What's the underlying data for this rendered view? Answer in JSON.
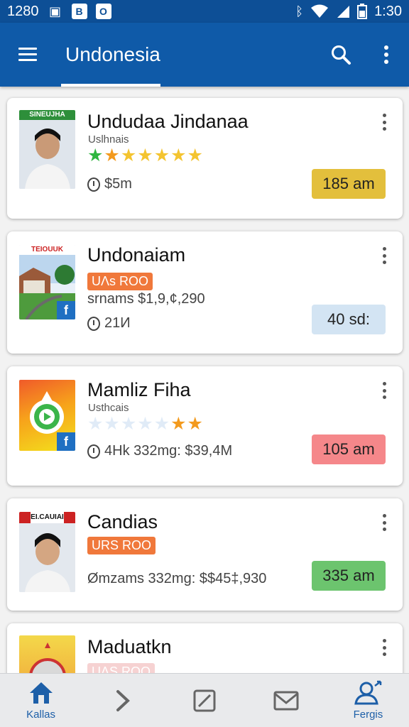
{
  "status_bar": {
    "time_left": "1280",
    "icons_left": [
      "gallery-icon",
      "b-icon",
      "o-icon"
    ],
    "time_right": "1:30"
  },
  "app_bar": {
    "title": "Undonesia",
    "actions": [
      "search-icon",
      "more-vert-icon"
    ]
  },
  "cards": [
    {
      "title": "Undudaa Jindanaa",
      "subtitle": "Uslhnais",
      "thumb_caption": "SINEUJHA",
      "rating_stars": 7,
      "meta": "$5m",
      "badge": "185 am",
      "badge_color": "#e3bf3c"
    },
    {
      "title": "Undonaiam",
      "tag": "UΛs ROO",
      "thumb_caption": "TEIOUUK",
      "line2": "srnams  $1,9,¢,290",
      "meta": "21И",
      "badge": "40 sd:",
      "badge_color": "#d3e4f3"
    },
    {
      "title": "Mamliz Fiha",
      "subtitle": "Usthcais",
      "rating_stars": 2,
      "meta": "4Hk   332mg:  $39,4M",
      "badge": "105 am",
      "badge_color": "#f5878a"
    },
    {
      "title": "Candias",
      "tag": "URS ROO",
      "thumb_caption": "EI.CAUIAI",
      "meta": "Ømzams  332mg:  $$45‡,930",
      "badge": "335 am",
      "badge_color": "#6cc46e"
    },
    {
      "title": "Maduatkn",
      "tag": "UΛS ROO"
    }
  ],
  "bottom_nav": [
    {
      "label": "Kallas",
      "icon": "home-icon"
    },
    {
      "label": "",
      "icon": "chevron-right-icon"
    },
    {
      "label": "",
      "icon": "edit-box-icon"
    },
    {
      "label": "",
      "icon": "mail-icon"
    },
    {
      "label": "Fergis",
      "icon": "person-icon"
    }
  ],
  "colors": {
    "app_bar": "#0f5aa8",
    "status_bar": "#0d4f96",
    "star_gold": "#f4c430",
    "star_orange": "#f39a1e",
    "star_green": "#2fb640"
  }
}
